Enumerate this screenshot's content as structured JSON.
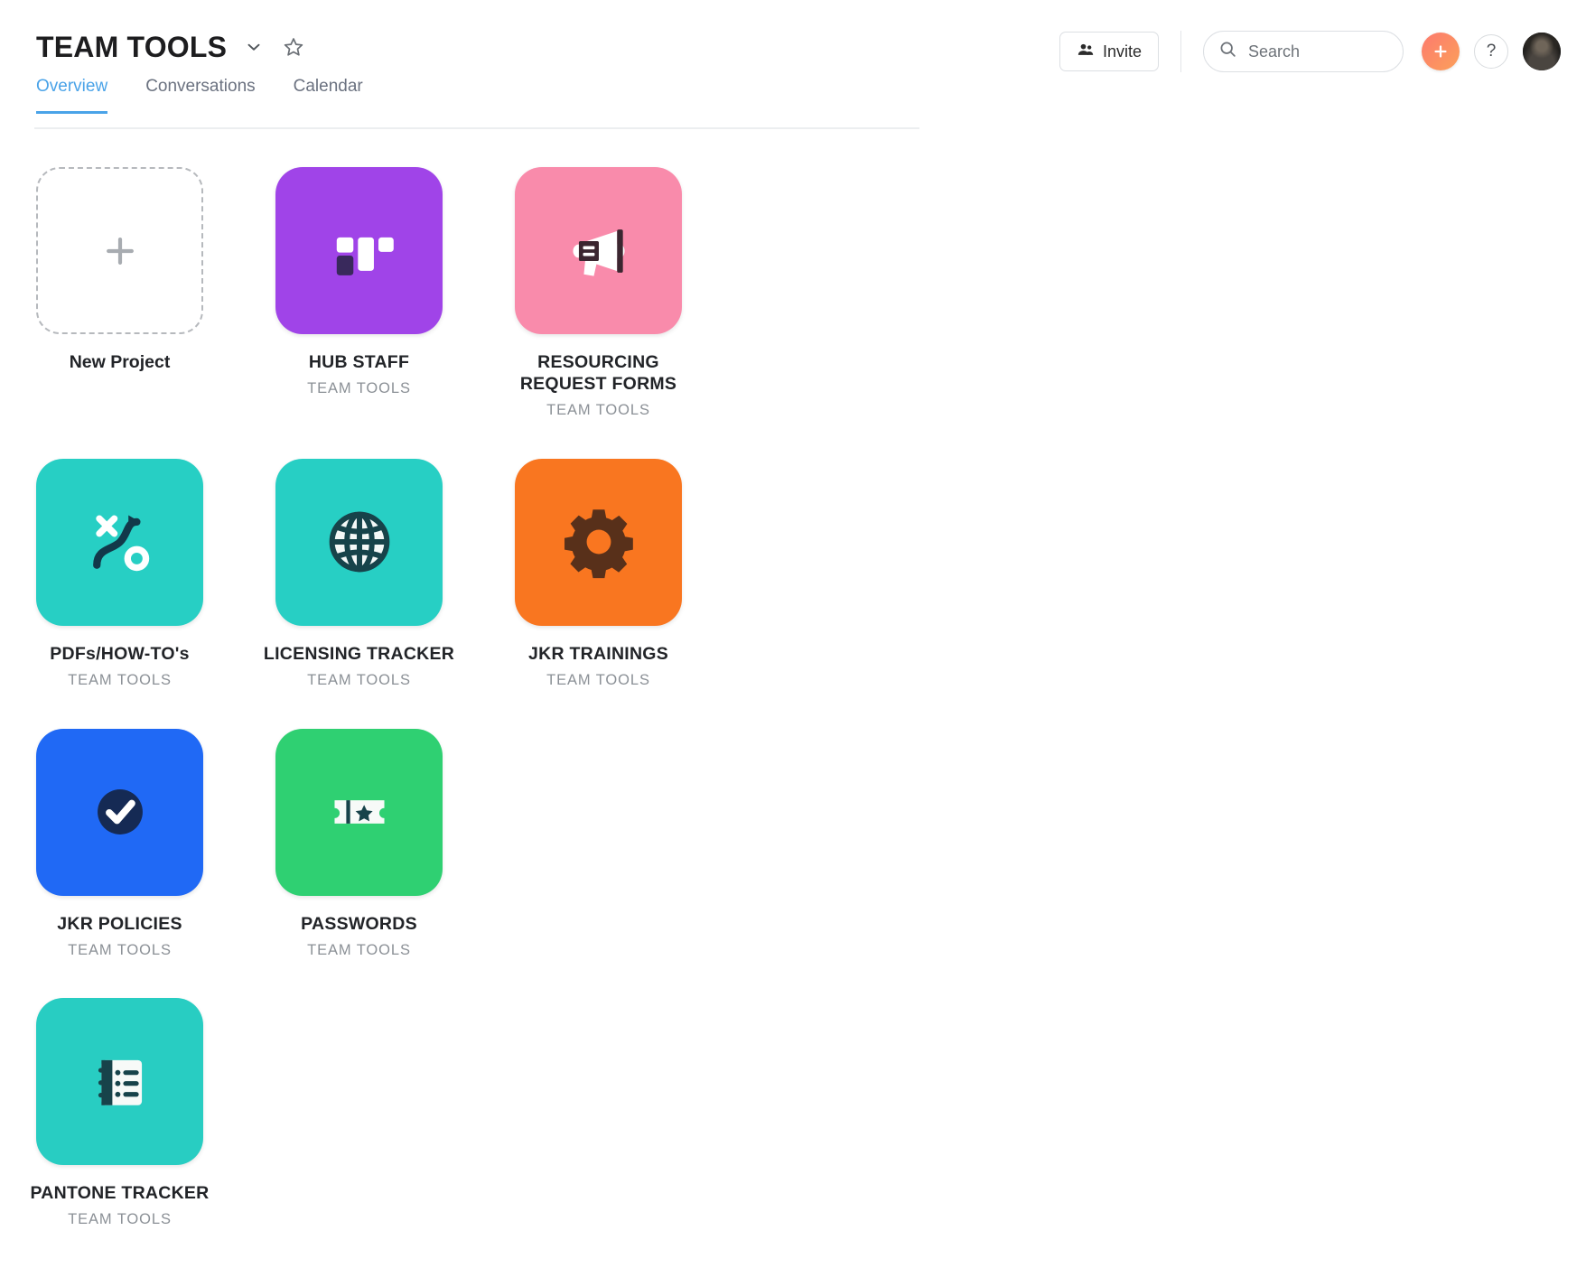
{
  "header": {
    "title": "TEAM TOOLS",
    "chevron_icon": "chevron-down-icon",
    "star_icon": "star-outline-icon",
    "tabs": [
      {
        "label": "Overview",
        "active": true
      },
      {
        "label": "Conversations",
        "active": false
      },
      {
        "label": "Calendar",
        "active": false
      }
    ],
    "invite_label": "Invite",
    "invite_icon": "people-icon",
    "search": {
      "placeholder": "Search",
      "value": "",
      "icon": "search-icon"
    },
    "add_button_label": "+",
    "help_button_label": "?",
    "avatar_name": "user-avatar",
    "accent_color": "#4aa3e8",
    "add_button_color": "#fd8467"
  },
  "grid": {
    "new_project": {
      "label": "New Project",
      "icon": "plus-icon"
    },
    "projects": [
      {
        "name": "HUB STAFF",
        "team": "TEAM TOOLS",
        "color": "#a044e8",
        "icon": "board-columns-icon"
      },
      {
        "name": "RESOURCING REQUEST FORMS",
        "team": "TEAM TOOLS",
        "color": "#f98bab",
        "icon": "megaphone-icon"
      },
      {
        "name": "PDFs/HOW-TO's",
        "team": "TEAM TOOLS",
        "color": "#27cfc4",
        "icon": "strategy-icon"
      },
      {
        "name": "LICENSING TRACKER",
        "team": "TEAM TOOLS",
        "color": "#27cfc4",
        "icon": "globe-icon"
      },
      {
        "name": "JKR TRAININGS",
        "team": "TEAM TOOLS",
        "color": "#f97620",
        "icon": "gear-icon"
      },
      {
        "name": "JKR POLICIES",
        "team": "TEAM TOOLS",
        "color": "#2069f5",
        "icon": "check-circle-icon"
      },
      {
        "name": "PASSWORDS",
        "team": "TEAM TOOLS",
        "color": "#2fd072",
        "icon": "ticket-star-icon"
      },
      {
        "name": "PANTONE TRACKER",
        "team": "TEAM TOOLS",
        "color": "#28cdc2",
        "icon": "notebook-list-icon"
      }
    ]
  }
}
